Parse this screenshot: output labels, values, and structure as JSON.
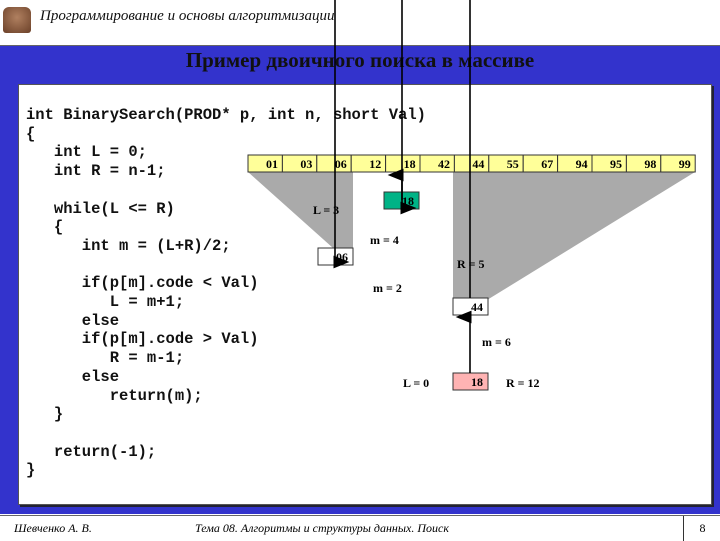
{
  "header": {
    "course": "Программирование и основы алгоритмизации"
  },
  "slide": {
    "title": "Пример двоичного поиска в массиве"
  },
  "code": "int BinarySearch(PROD* p, int n, short Val)\n{\n   int L = 0;\n   int R = n-1;\n\n   while(L <= R)\n   {\n      int m = (L+R)/2;\n\n      if(p[m].code < Val)\n         L = m+1;\n      else\n      if(p[m].code > Val)\n         R = m-1;\n      else\n         return(m);\n   }\n\n   return(-1);\n}",
  "array": [
    "01",
    "03",
    "06",
    "12",
    "18",
    "42",
    "44",
    "55",
    "67",
    "94",
    "95",
    "98",
    "99"
  ],
  "boxes": {
    "found": "18",
    "step2": "06",
    "step1": "44",
    "target": "18"
  },
  "labels": {
    "l3": "L = 3",
    "m4": "m = 4",
    "r5": "R = 5",
    "m2": "m = 2",
    "m6": "m = 6",
    "l0": "L = 0",
    "r12": "R = 12"
  },
  "colors": {
    "band": "#3333cc",
    "array": "#ffff99",
    "found": "#00b386",
    "target": "#ffb3b3",
    "shade": "#aaaaaa"
  },
  "footer": {
    "author": "Шевченко А. В.",
    "topic": "Тема 08. Алгоритмы и структуры данных. Поиск",
    "page": "8"
  }
}
